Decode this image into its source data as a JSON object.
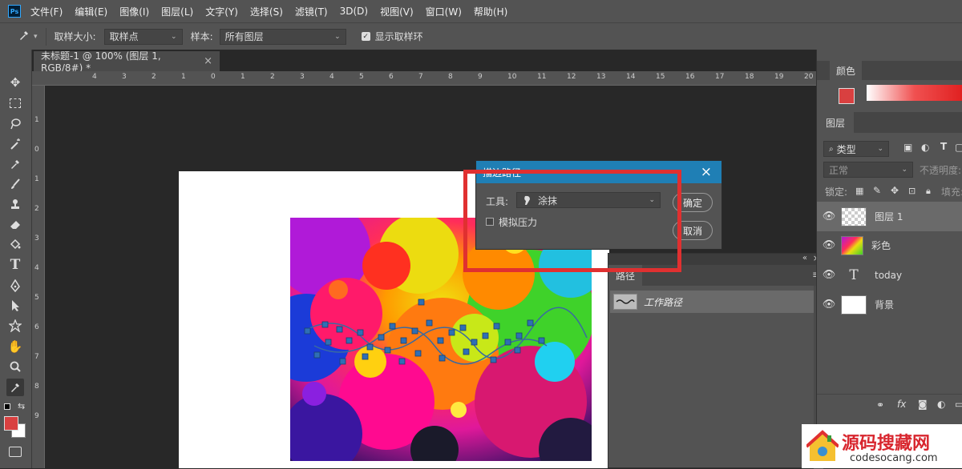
{
  "app": {
    "logo": "Ps"
  },
  "menu": [
    "文件(F)",
    "编辑(E)",
    "图像(I)",
    "图层(L)",
    "文字(Y)",
    "选择(S)",
    "滤镜(T)",
    "3D(D)",
    "视图(V)",
    "窗口(W)",
    "帮助(H)"
  ],
  "options": {
    "sample_size_label": "取样大小:",
    "sample_size_value": "取样点",
    "sample_label": "样本:",
    "sample_value": "所有图层",
    "show_ring_label": "显示取样环",
    "show_ring_checked": true
  },
  "doc_tab": {
    "title": "未标题-1 @ 100% (图层 1, RGB/8#) *",
    "close": "×"
  },
  "ruler_top": [
    "4",
    "3",
    "2",
    "1",
    "0",
    "1",
    "2",
    "3",
    "4",
    "5",
    "6",
    "7",
    "8",
    "9",
    "10",
    "11",
    "12",
    "13",
    "14",
    "15",
    "16",
    "17",
    "18",
    "19",
    "20",
    "21"
  ],
  "ruler_left": [
    "1",
    "0",
    "1",
    "2",
    "3",
    "4",
    "5",
    "6",
    "7",
    "8",
    "9"
  ],
  "dialog": {
    "title": "描边路径",
    "tool_label": "工具:",
    "tool_value": "涂抹",
    "simulate_pressure_label": "模拟压力",
    "simulate_pressure_checked": false,
    "ok_label": "确定",
    "cancel_label": "取消",
    "close": "×"
  },
  "paths_panel": {
    "tab": "路径",
    "items": [
      {
        "name": "工作路径"
      }
    ]
  },
  "color_panel": {
    "tab": "颜色",
    "fg": "#d94040",
    "bg": "#ffffff"
  },
  "layers_panel": {
    "tab": "图层",
    "filter_label": "类型",
    "blend_mode": "正常",
    "opacity_label": "不透明度:",
    "lock_label": "锁定:",
    "fill_label": "填充:",
    "layers": [
      {
        "name": "图层 1",
        "visible": true,
        "type": "transparent"
      },
      {
        "name": "彩色",
        "visible": true,
        "type": "image"
      },
      {
        "name": "today",
        "visible": true,
        "type": "text"
      },
      {
        "name": "背景",
        "visible": true,
        "type": "white"
      }
    ]
  },
  "watermark": {
    "title": "源码搜藏网",
    "url": "codesocang.com"
  },
  "colors": {
    "highlight": "#e03030",
    "dialog_title": "#1f7fb5"
  }
}
